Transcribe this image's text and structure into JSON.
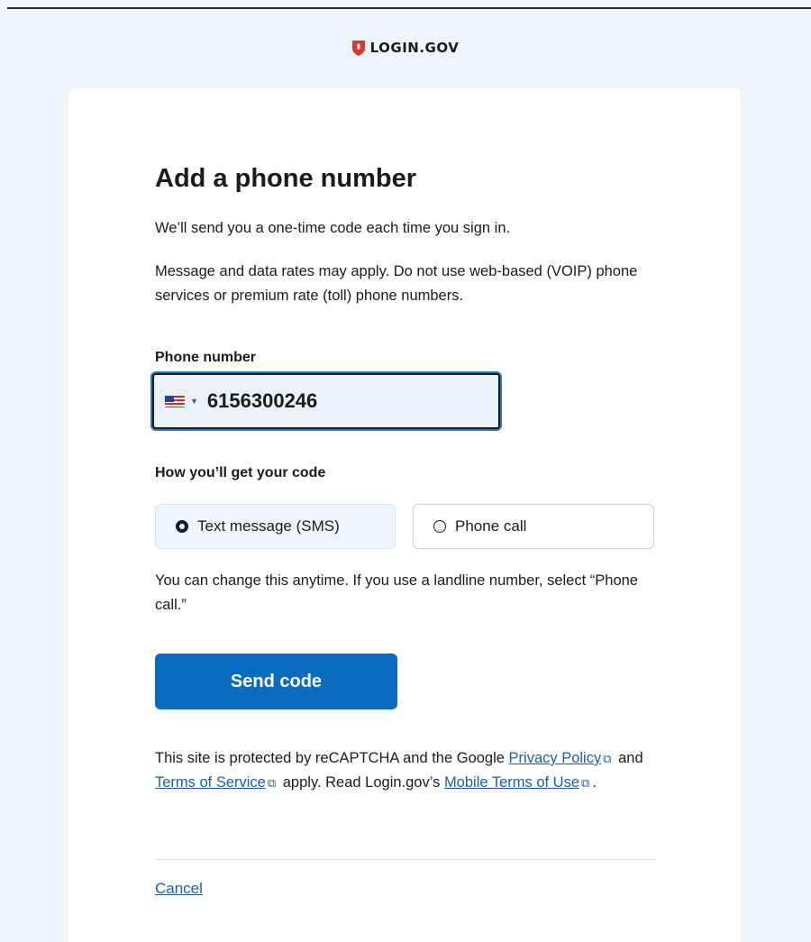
{
  "brand": {
    "logo_text": "LOGIN.GOV",
    "logo_icon": "shield-icon",
    "accent": "#d83933"
  },
  "page": {
    "title": "Add a phone number",
    "intro": "We’ll send you a one-time code each time you sign in.",
    "rates_notice": "Message and data rates may apply. Do not use web-based (VOIP) phone services or premium rate (toll) phone numbers."
  },
  "phone": {
    "label": "Phone number",
    "country_flag": "us-flag-icon",
    "value": "6156300246"
  },
  "delivery": {
    "label": "How you’ll get your code",
    "options": [
      {
        "label": "Text message (SMS)",
        "selected": true
      },
      {
        "label": "Phone call",
        "selected": false
      }
    ],
    "help": "You can change this anytime. If you use a landline number, select “Phone call.”"
  },
  "actions": {
    "send_label": "Send code",
    "send_color": "#0a6cbf",
    "cancel_label": "Cancel"
  },
  "legal": {
    "part1": "This site is protected by reCAPTCHA and the Google ",
    "privacy_link": "Privacy Policy",
    "part2": " and ",
    "terms_link": "Terms of Service",
    "part3": " apply. Read Login.gov’s ",
    "mobile_link": "Mobile Terms of Use",
    "part4": "."
  }
}
